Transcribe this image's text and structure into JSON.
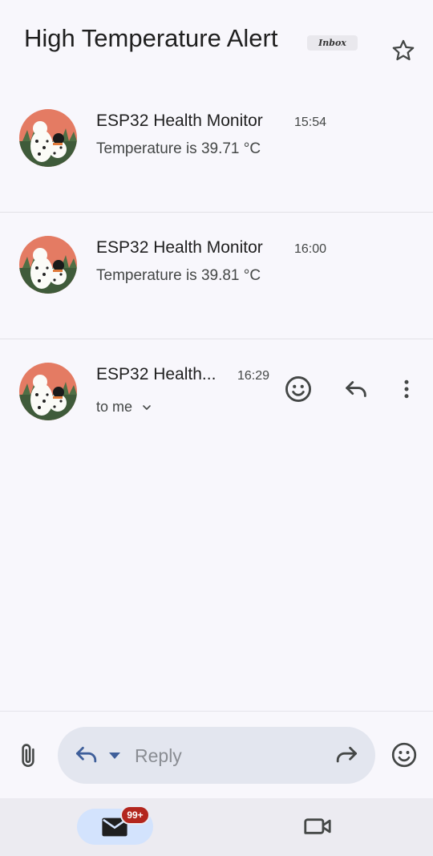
{
  "thread": {
    "subject": "High Temperature Alert",
    "label": "Inbox"
  },
  "messages": [
    {
      "sender": "ESP32 Health Monitor",
      "time": "15:54",
      "snippet": "Temperature is 39.71 °C"
    },
    {
      "sender": "ESP32 Health Monitor",
      "time": "16:00",
      "snippet": "Temperature is 39.81 °C"
    },
    {
      "sender": "ESP32 Health...",
      "time": "16:29",
      "recipient": "to me"
    }
  ],
  "compose": {
    "reply_placeholder": "Reply"
  },
  "bottom_nav": {
    "mail_badge": "99+"
  },
  "icons": [
    "star-icon",
    "avatar",
    "emoji-react-icon",
    "reply-icon",
    "more-vert-icon",
    "chevron-down-icon",
    "attach-icon",
    "reply-arrow-icon",
    "dropdown-icon",
    "forward-icon",
    "emoji-icon",
    "mail-icon",
    "video-icon"
  ],
  "colors": {
    "accent": "#d3e3fd",
    "badge": "#b3261e",
    "background": "#f8f7fc"
  }
}
